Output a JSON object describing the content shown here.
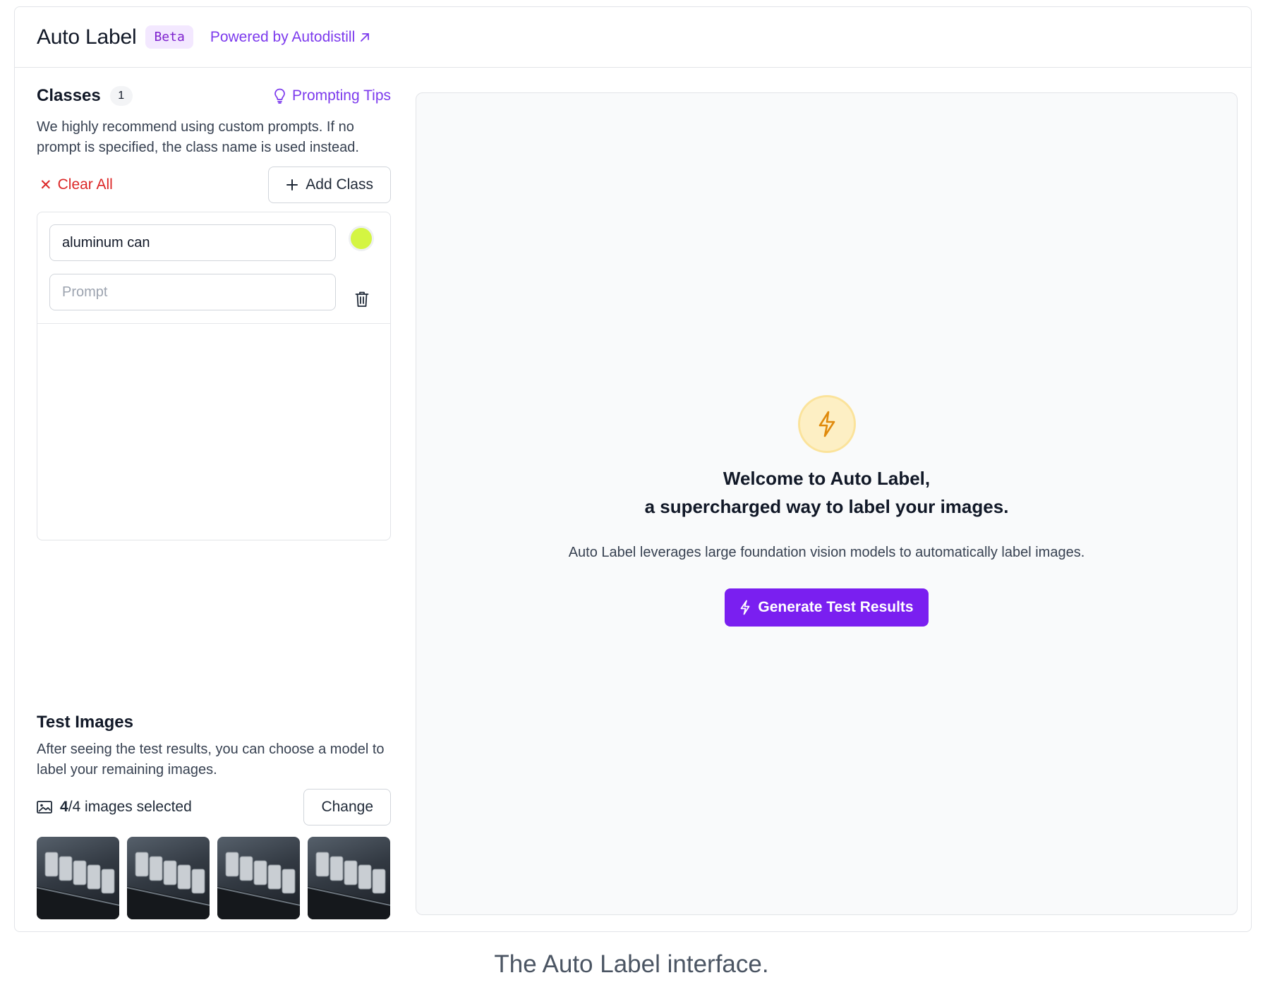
{
  "header": {
    "title": "Auto Label",
    "badge": "Beta",
    "powered_link": "Powered by Autodistill"
  },
  "classes": {
    "title": "Classes",
    "count": "1",
    "tips_link": "Prompting Tips",
    "description": "We highly recommend using custom prompts. If no prompt is specified, the class name is used instead.",
    "clear_all": "Clear All",
    "add_class": "Add Class",
    "items": [
      {
        "name": "aluminum can",
        "prompt_placeholder": "Prompt",
        "color": "#d4f542"
      }
    ]
  },
  "test_images": {
    "title": "Test Images",
    "description": "After seeing the test results, you can choose a model to label your remaining images.",
    "selected_count": "4",
    "total_label": "/4 images selected",
    "change_button": "Change",
    "thumbnails": [
      "thumbnail-1",
      "thumbnail-2",
      "thumbnail-3",
      "thumbnail-4"
    ]
  },
  "main": {
    "welcome_line1": "Welcome to Auto Label,",
    "welcome_line2": "a supercharged way to label your images.",
    "lead": "Auto Label leverages large foundation vision models to automatically label images.",
    "generate_button": "Generate Test Results"
  },
  "caption": "The Auto Label interface.",
  "colors": {
    "accent": "#7a1ff0",
    "danger": "#dc2626",
    "bolt_bg": "#fdefc4"
  }
}
